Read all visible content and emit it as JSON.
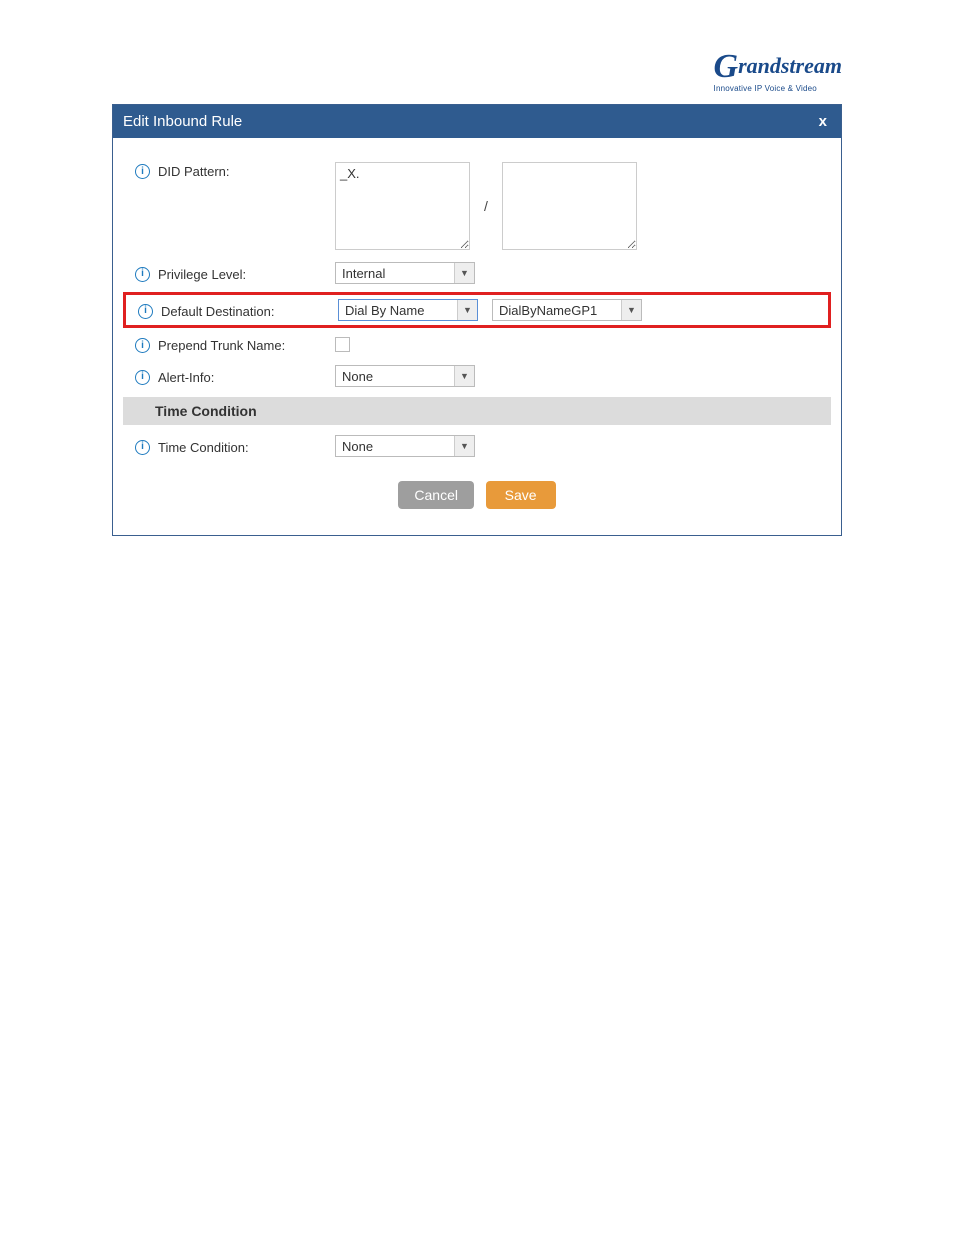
{
  "logo": {
    "brand": "Grandstream",
    "tagline": "Innovative IP Voice & Video"
  },
  "dialog": {
    "title": "Edit Inbound Rule",
    "close": "x"
  },
  "fields": {
    "did_pattern": {
      "label": "DID Pattern:",
      "value1": "_X.",
      "separator": "/",
      "value2": ""
    },
    "privilege_level": {
      "label": "Privilege Level:",
      "value": "Internal"
    },
    "default_destination": {
      "label": "Default Destination:",
      "value1": "Dial By Name",
      "value2": "DialByNameGP1"
    },
    "prepend_trunk_name": {
      "label": "Prepend Trunk Name:"
    },
    "alert_info": {
      "label": "Alert-Info:",
      "value": "None"
    },
    "time_condition_section": "Time Condition",
    "time_condition": {
      "label": "Time Condition:",
      "value": "None"
    }
  },
  "buttons": {
    "cancel": "Cancel",
    "save": "Save"
  }
}
